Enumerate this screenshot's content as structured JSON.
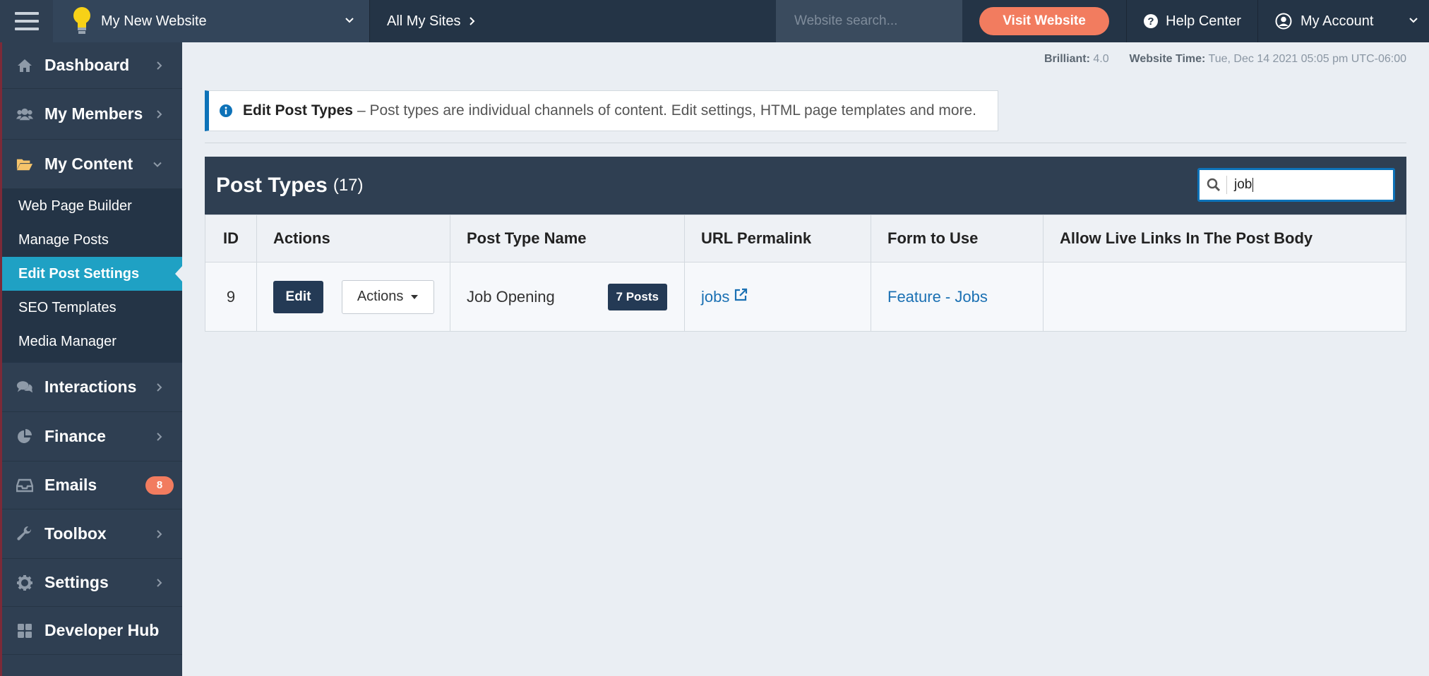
{
  "topbar": {
    "site_name": "My New Website",
    "all_sites": "All My Sites",
    "search_placeholder": "Website search...",
    "visit_label": "Visit Website",
    "help_label": "Help Center",
    "account_label": "My Account"
  },
  "sidebar": {
    "items": [
      {
        "label": "Dashboard",
        "icon": "home-icon"
      },
      {
        "label": "My Members",
        "icon": "users-icon"
      },
      {
        "label": "My Content",
        "icon": "folder-open-icon"
      },
      {
        "label": "Interactions",
        "icon": "comments-icon"
      },
      {
        "label": "Finance",
        "icon": "pie-chart-icon"
      },
      {
        "label": "Emails",
        "icon": "inbox-icon",
        "badge": "8"
      },
      {
        "label": "Toolbox",
        "icon": "wrench-icon"
      },
      {
        "label": "Settings",
        "icon": "gear-icon"
      },
      {
        "label": "Developer Hub",
        "icon": "grid-icon"
      }
    ],
    "submenu": [
      {
        "label": "Web Page Builder"
      },
      {
        "label": "Manage Posts"
      },
      {
        "label": "Edit Post Settings",
        "active": true
      },
      {
        "label": "SEO Templates"
      },
      {
        "label": "Media Manager"
      }
    ]
  },
  "meta": {
    "version_label": "Brilliant:",
    "version_value": "4.0",
    "time_label": "Website Time:",
    "time_value": "Tue, Dec 14 2021 05:05 pm UTC-06:00"
  },
  "info": {
    "title": "Edit Post Types",
    "text": "– Post types are individual channels of content. Edit settings, HTML page templates and more."
  },
  "panel": {
    "title": "Post Types",
    "count": "(17)",
    "search_value": "job"
  },
  "table": {
    "headers": [
      "ID",
      "Actions",
      "Post Type Name",
      "URL Permalink",
      "Form to Use",
      "Allow Live Links In The Post Body"
    ],
    "rows": [
      {
        "id": "9",
        "edit_label": "Edit",
        "actions_label": "Actions",
        "name": "Job Opening",
        "posts_badge": "7 Posts",
        "permalink": "jobs",
        "form": "Feature - Jobs",
        "live_links": ""
      }
    ]
  },
  "colors": {
    "topbar": "#243446",
    "sidebar": "#2f3f52",
    "accent_orange": "#f27c5f",
    "active_teal": "#1fa1c4",
    "link_blue": "#1a70b3"
  }
}
